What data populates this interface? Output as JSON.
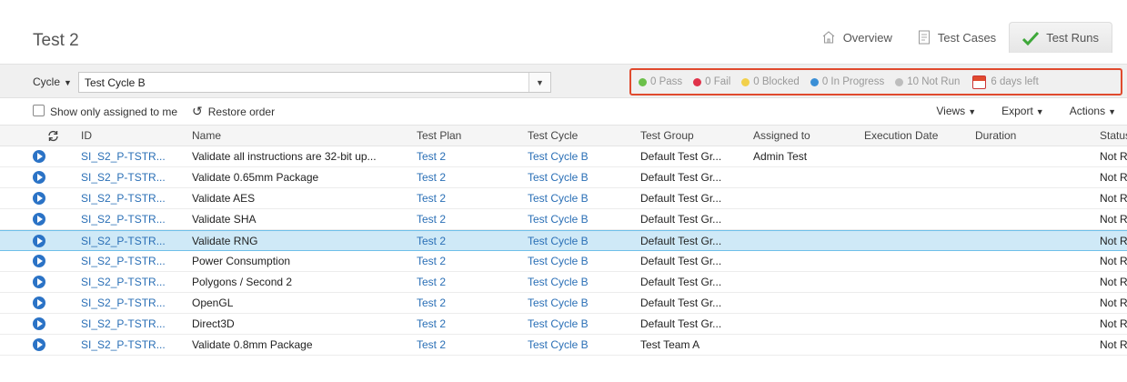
{
  "header": {
    "title": "Test 2",
    "tabs": [
      {
        "label": "Overview",
        "icon": "home-icon",
        "active": false
      },
      {
        "label": "Test Cases",
        "icon": "document-icon",
        "active": false
      },
      {
        "label": "Test Runs",
        "icon": "checkmark-icon",
        "active": true
      }
    ]
  },
  "toolbar": {
    "cycle_label": "Cycle",
    "cycle_value": "Test Cycle B",
    "status": {
      "pass": "0 Pass",
      "fail": "0 Fail",
      "blocked": "0 Blocked",
      "in_progress": "0 In Progress",
      "not_run": "10 Not Run",
      "days_left": "6 days left"
    },
    "status_colors": {
      "pass": "#6cc04a",
      "fail": "#e0334a",
      "blocked": "#f2d04b",
      "in_progress": "#3a8fd6",
      "not_run": "#bdbdbd"
    }
  },
  "options": {
    "assigned_label": "Show only assigned to me",
    "restore_label": "Restore order",
    "views": "Views",
    "export": "Export",
    "actions": "Actions"
  },
  "table": {
    "columns": {
      "id": "ID",
      "name": "Name",
      "plan": "Test Plan",
      "cycle": "Test Cycle",
      "group": "Test Group",
      "assigned": "Assigned to",
      "date": "Execution Date",
      "duration": "Duration",
      "status": "Status"
    },
    "rows": [
      {
        "id": "SI_S2_P-TSTR...",
        "name": "Validate all instructions are 32-bit up...",
        "plan": "Test 2",
        "cycle": "Test Cycle B",
        "group": "Default Test Gr...",
        "assigned": "Admin Test",
        "date": "",
        "duration": "",
        "status": "Not Ru"
      },
      {
        "id": "SI_S2_P-TSTR...",
        "name": "Validate 0.65mm Package",
        "plan": "Test 2",
        "cycle": "Test Cycle B",
        "group": "Default Test Gr...",
        "assigned": "",
        "date": "",
        "duration": "",
        "status": "Not Ru"
      },
      {
        "id": "SI_S2_P-TSTR...",
        "name": "Validate AES",
        "plan": "Test 2",
        "cycle": "Test Cycle B",
        "group": "Default Test Gr...",
        "assigned": "",
        "date": "",
        "duration": "",
        "status": "Not Ru"
      },
      {
        "id": "SI_S2_P-TSTR...",
        "name": "Validate SHA",
        "plan": "Test 2",
        "cycle": "Test Cycle B",
        "group": "Default Test Gr...",
        "assigned": "",
        "date": "",
        "duration": "",
        "status": "Not Ru"
      },
      {
        "id": "SI_S2_P-TSTR...",
        "name": "Validate RNG",
        "plan": "Test 2",
        "cycle": "Test Cycle B",
        "group": "Default Test Gr...",
        "assigned": "",
        "date": "",
        "duration": "",
        "status": "Not Ru",
        "selected": true
      },
      {
        "id": "SI_S2_P-TSTR...",
        "name": "Power Consumption",
        "plan": "Test 2",
        "cycle": "Test Cycle B",
        "group": "Default Test Gr...",
        "assigned": "",
        "date": "",
        "duration": "",
        "status": "Not Ru"
      },
      {
        "id": "SI_S2_P-TSTR...",
        "name": "Polygons / Second 2",
        "plan": "Test 2",
        "cycle": "Test Cycle B",
        "group": "Default Test Gr...",
        "assigned": "",
        "date": "",
        "duration": "",
        "status": "Not Ru"
      },
      {
        "id": "SI_S2_P-TSTR...",
        "name": "OpenGL",
        "plan": "Test 2",
        "cycle": "Test Cycle B",
        "group": "Default Test Gr...",
        "assigned": "",
        "date": "",
        "duration": "",
        "status": "Not Ru"
      },
      {
        "id": "SI_S2_P-TSTR...",
        "name": "Direct3D",
        "plan": "Test 2",
        "cycle": "Test Cycle B",
        "group": "Default Test Gr...",
        "assigned": "",
        "date": "",
        "duration": "",
        "status": "Not Ru"
      },
      {
        "id": "SI_S2_P-TSTR...",
        "name": "Validate 0.8mm Package",
        "plan": "Test 2",
        "cycle": "Test Cycle B",
        "group": "Test Team A",
        "assigned": "",
        "date": "",
        "duration": "",
        "status": "Not Ru"
      }
    ]
  }
}
